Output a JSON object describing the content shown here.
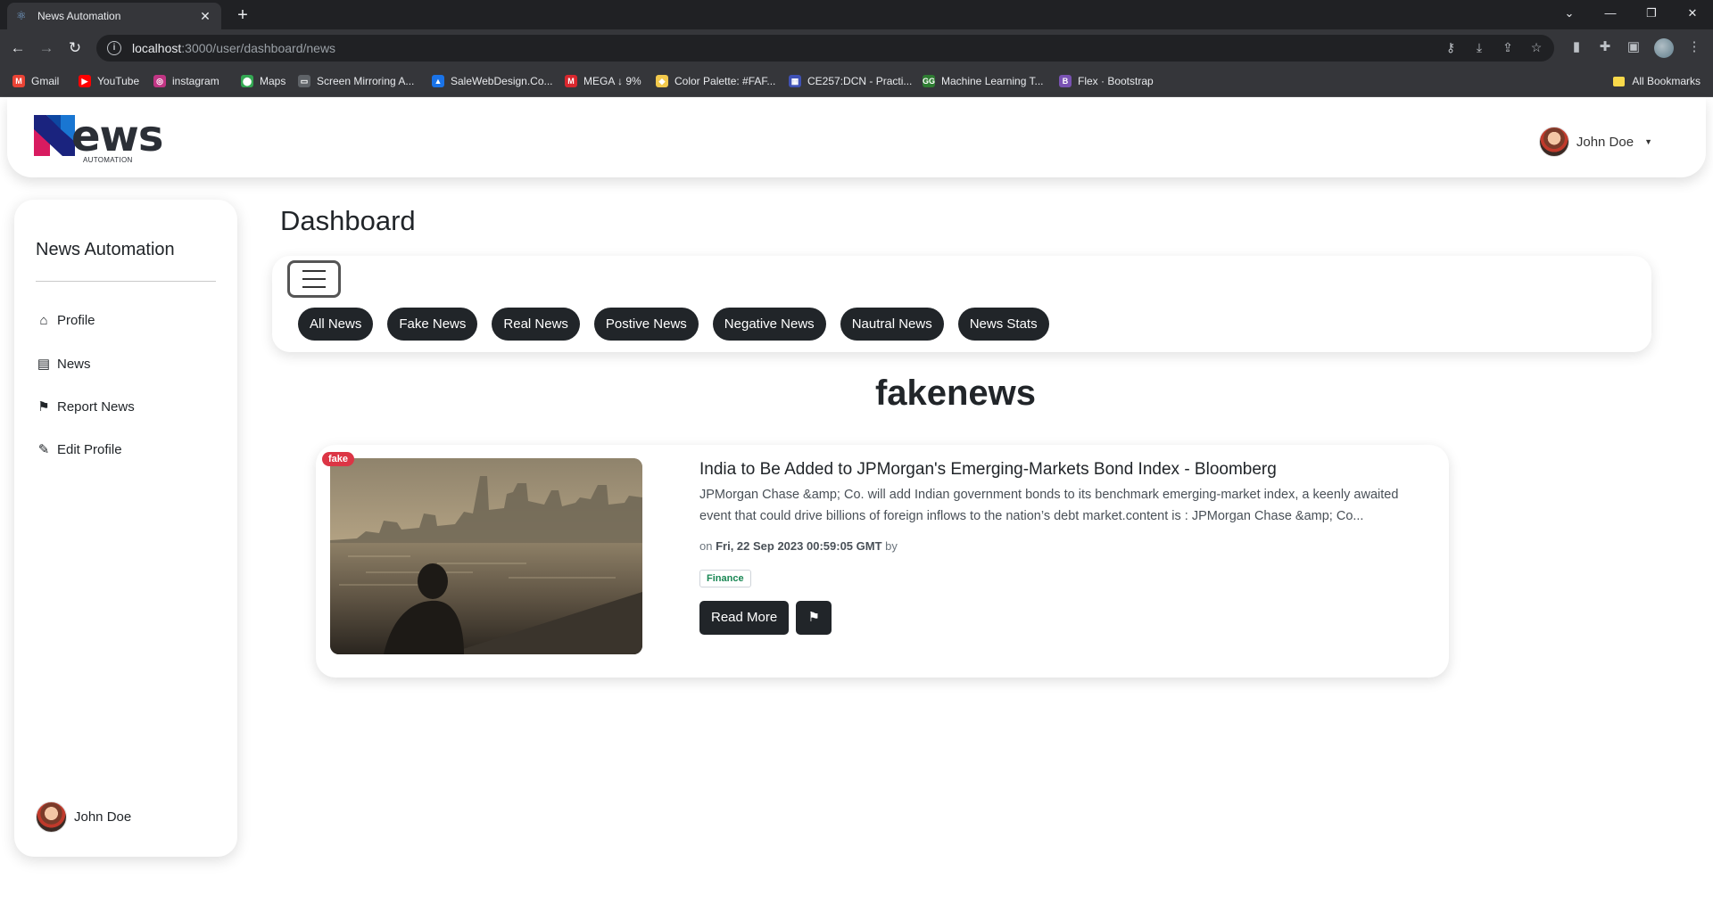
{
  "browser": {
    "tab_title": "News Automation",
    "url_host": "localhost",
    "url_path": ":3000/user/dashboard/news",
    "bookmarks": [
      {
        "label": "Gmail",
        "color": "#ea4335",
        "glyph": "M"
      },
      {
        "label": "YouTube",
        "color": "#ff0000",
        "glyph": "▶"
      },
      {
        "label": "instagram",
        "color": "#c13584",
        "glyph": "◎"
      },
      {
        "label": "Maps",
        "color": "#34a853",
        "glyph": "⬤"
      },
      {
        "label": "Screen Mirroring A...",
        "color": "#5f6368",
        "glyph": "▭"
      },
      {
        "label": "SaleWebDesign.Co...",
        "color": "#1a73e8",
        "glyph": "▲"
      },
      {
        "label": "MEGA ↓ 9%",
        "color": "#d9272e",
        "glyph": "M"
      },
      {
        "label": "Color Palette: #FAF...",
        "color": "#f2c94c",
        "glyph": "◆"
      },
      {
        "label": "CE257:DCN - Practi...",
        "color": "#3f51b5",
        "glyph": "▦"
      },
      {
        "label": "Machine Learning T...",
        "color": "#2e7d32",
        "glyph": "GG"
      },
      {
        "label": "Flex · Bootstrap",
        "color": "#7952b3",
        "glyph": "B"
      }
    ],
    "all_bookmarks": "All Bookmarks"
  },
  "header": {
    "logo_word": "ews",
    "logo_sub": "AUTOMATION",
    "user_name": "John Doe"
  },
  "sidebar": {
    "title": "News Automation",
    "items": [
      {
        "label": "Profile",
        "icon": "home-icon"
      },
      {
        "label": "News",
        "icon": "newspaper-icon"
      },
      {
        "label": "Report News",
        "icon": "flag-icon"
      },
      {
        "label": "Edit Profile",
        "icon": "edit-icon"
      }
    ],
    "user_name": "John Doe"
  },
  "main": {
    "title": "Dashboard",
    "filters": [
      "All News",
      "Fake News",
      "Real News",
      "Postive News",
      "Negative News",
      "Nautral News",
      "News Stats"
    ],
    "section_title": "fakenews"
  },
  "article": {
    "badge": "fake",
    "title": "India to Be Added to JPMorgan's Emerging-Markets Bond Index - Bloomberg",
    "description": "JPMorgan Chase &amp; Co. will add Indian government bonds to its benchmark emerging-market index, a keenly awaited event that could drive billions of foreign inflows to the nation’s debt market.content is : JPMorgan Chase &amp; Co...",
    "meta_prefix": "on",
    "date": "Fri, 22 Sep 2023 00:59:05 GMT",
    "meta_suffix": "by",
    "category": "Finance",
    "read_more": "Read More"
  }
}
